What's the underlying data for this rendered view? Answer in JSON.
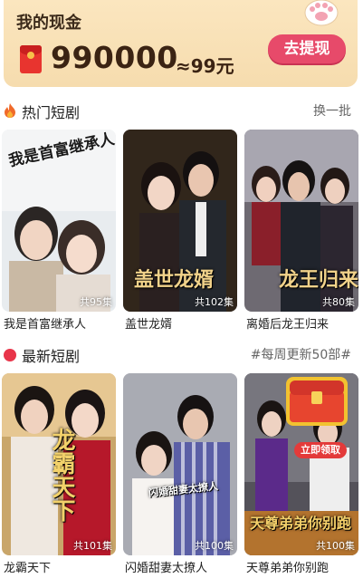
{
  "wallet": {
    "title": "我的现金",
    "amount": "990000",
    "approx": "≈99元",
    "withdraw_label": "去提现"
  },
  "hot_section": {
    "title": "热门短剧",
    "action": "换一批",
    "items": [
      {
        "title": "我是首富继承人",
        "episodes": "共95集",
        "art": "我是首富继承人"
      },
      {
        "title": "盖世龙婿",
        "episodes": "共102集",
        "art": "盖世龙婿"
      },
      {
        "title": "离婚后龙王归来",
        "episodes": "共80集",
        "art": "龙王归来"
      }
    ]
  },
  "new_section": {
    "title": "最新短剧",
    "action": "#每周更新50部#",
    "items": [
      {
        "title": "龙霸天下",
        "episodes": "共101集",
        "art": "龙霸天下"
      },
      {
        "title": "闪婚甜妻太撩人",
        "episodes": "共100集",
        "art": "闪婚甜妻太撩人"
      },
      {
        "title": "天尊弟弟你别跑",
        "episodes": "共100集",
        "art": "天尊弟弟你别跑",
        "badge": "立即领取"
      }
    ]
  },
  "colors": {
    "wallet_bg": "#f6dcae",
    "withdraw_button": "#e74a6a",
    "hot_icon": "#f06a2a",
    "new_icon": "#e8354a"
  }
}
